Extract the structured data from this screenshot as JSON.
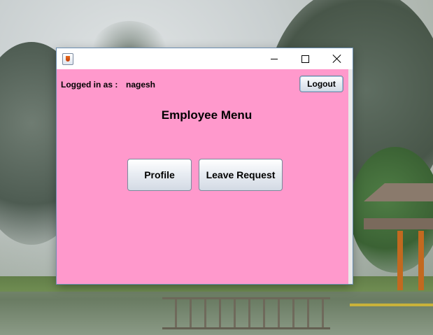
{
  "desktop": {
    "background": "forest lake wallpaper"
  },
  "window": {
    "title": "",
    "icon": "java-cup-icon",
    "controls": {
      "minimize": "minimize-icon",
      "maximize": "maximize-icon",
      "close": "close-icon"
    }
  },
  "session": {
    "logged_in_label": "Logged in as :",
    "username": "nagesh",
    "logout_label": "Logout"
  },
  "menu": {
    "heading": "Employee Menu",
    "profile_label": "Profile",
    "leave_request_label": "Leave Request"
  },
  "colors": {
    "panel_background": "#ff99cc"
  }
}
